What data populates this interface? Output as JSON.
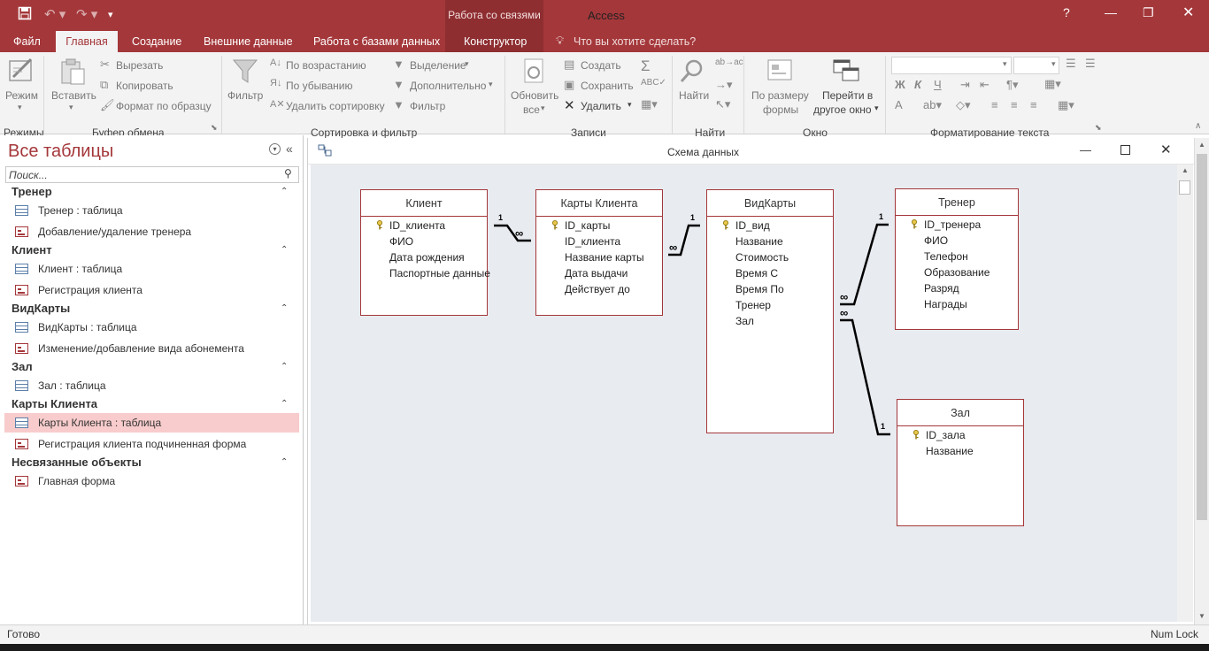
{
  "titlebar": {
    "context_title": "Работа со связями",
    "app_title": "Access",
    "help": "?"
  },
  "tabs": {
    "file": "Файл",
    "home": "Главная",
    "create": "Создание",
    "external": "Внешние данные",
    "database": "Работа с базами данных",
    "designer": "Конструктор",
    "tellme": "Что вы хотите сделать?"
  },
  "ribbon": {
    "views": {
      "mode": "Режим",
      "group": "Режимы"
    },
    "clipboard": {
      "paste": "Вставить",
      "cut": "Вырезать",
      "copy": "Копировать",
      "format_painter": "Формат по образцу",
      "group": "Буфер обмена"
    },
    "sort": {
      "filter": "Фильтр",
      "asc": "По возрастанию",
      "desc": "По убыванию",
      "remove_sort": "Удалить сортировку",
      "selection": "Выделение",
      "advanced": "Дополнительно",
      "toggle_filter": "Фильтр",
      "group": "Сортировка и фильтр"
    },
    "records": {
      "refresh_line1": "Обновить",
      "refresh_line2": "все",
      "new": "Создать",
      "save": "Сохранить",
      "delete": "Удалить",
      "group": "Записи"
    },
    "find": {
      "find": "Найти",
      "ab_label": "ab→ac",
      "group": "Найти"
    },
    "window": {
      "fit_line1": "По размеру",
      "fit_line2": "формы",
      "switch_line1": "Перейти в",
      "switch_line2": "другое окно",
      "group": "Окно"
    },
    "text": {
      "bold": "Ж",
      "italic": "К",
      "underline": "Ч",
      "font_color": "A",
      "group": "Форматирование текста"
    }
  },
  "nav": {
    "title": "Все таблицы",
    "search_placeholder": "Поиск...",
    "groups": [
      {
        "name": "Тренер",
        "items": [
          {
            "label": "Тренер : таблица",
            "type": "table"
          },
          {
            "label": "Добавление/удаление тренера",
            "type": "form"
          }
        ]
      },
      {
        "name": "Клиент",
        "items": [
          {
            "label": "Клиент : таблица",
            "type": "table"
          },
          {
            "label": "Регистрация клиента",
            "type": "form"
          }
        ]
      },
      {
        "name": "ВидКарты",
        "items": [
          {
            "label": "ВидКарты : таблица",
            "type": "table"
          },
          {
            "label": "Изменение/добавление вида абонемента",
            "type": "form"
          }
        ]
      },
      {
        "name": "Зал",
        "items": [
          {
            "label": "Зал : таблица",
            "type": "table"
          }
        ]
      },
      {
        "name": "Карты Клиента",
        "items": [
          {
            "label": "Карты Клиента : таблица",
            "type": "table",
            "selected": true
          },
          {
            "label": "Регистрация клиента подчиненная форма",
            "type": "form"
          }
        ]
      },
      {
        "name": "Несвязанные объекты",
        "items": [
          {
            "label": "Главная форма",
            "type": "form"
          }
        ]
      }
    ]
  },
  "diagram": {
    "title": "Схема данных",
    "tables": [
      {
        "name": "Клиент",
        "key": "ID_клиента",
        "fields": [
          "ФИО",
          "Дата рождения",
          "Паспортные данные"
        ]
      },
      {
        "name": "Карты Клиента",
        "key": "ID_карты",
        "fields": [
          "ID_клиента",
          "Название карты",
          "Дата выдачи",
          "Действует до"
        ]
      },
      {
        "name": "ВидКарты",
        "key": "ID_вид",
        "fields": [
          "Название",
          "Стоимость",
          "Время С",
          "Время По",
          "Тренер",
          "Зал"
        ]
      },
      {
        "name": "Тренер",
        "key": "ID_тренера",
        "fields": [
          "ФИО",
          "Телефон",
          "Образование",
          "Разряд",
          "Награды"
        ]
      },
      {
        "name": "Зал",
        "key": "ID_зала",
        "fields": [
          "Название"
        ]
      }
    ],
    "cardinality": {
      "one": "1",
      "many": "∞"
    }
  },
  "status": {
    "left": "Готово",
    "right": "Num Lock"
  },
  "colors": {
    "accent": "#a4373a",
    "selected": "#f8cccc"
  }
}
